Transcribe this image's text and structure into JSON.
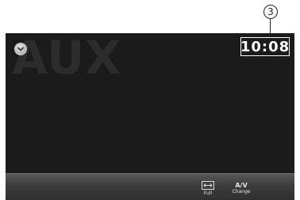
{
  "callout": {
    "number": "3"
  },
  "screen": {
    "source_label": "AUX",
    "clock": "10:08",
    "menu_icon": "chevron-down-icon"
  },
  "bottom_bar": {
    "full_label": "Full",
    "av_label_top": "A/V",
    "av_label_bottom": "Change"
  }
}
